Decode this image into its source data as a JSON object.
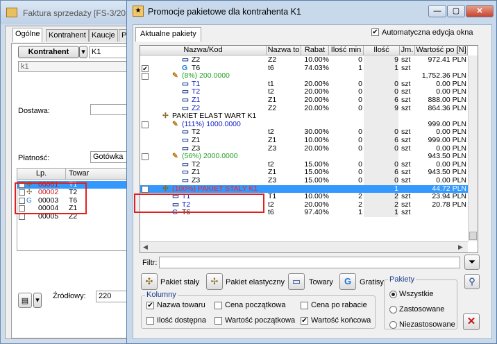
{
  "back": {
    "title": "Faktura sprzedaży [FS-3/201",
    "tabs": [
      "Ogólne",
      "Kontrahent",
      "Kaucje",
      "P"
    ],
    "kontrahent_button": "Kontrahent",
    "kontrahent_value": "K1",
    "kontrahent_name": "k1",
    "dostawa_label": "Dostawa:",
    "platnosc_label": "Płatność:",
    "platnosc_value": "Gotówka",
    "cols": [
      "Lp.",
      "Towar"
    ],
    "rows": [
      {
        "lp": "00001",
        "towar": "T1",
        "red": true,
        "sel": true
      },
      {
        "lp": "00002",
        "towar": "T2",
        "red": true
      },
      {
        "lp": "00003",
        "towar": "T6"
      },
      {
        "lp": "00004",
        "towar": "Z1"
      },
      {
        "lp": "00005",
        "towar": "Z2"
      }
    ],
    "zrodlowy_label": "Źródłowy:",
    "zrodlowy_value": "220"
  },
  "front": {
    "title": "Promocje pakietowe dla kontrahenta K1",
    "tab": "Aktualne pakiety",
    "auto_edit": "Automatyczna edycja okna",
    "grid": {
      "headers": [
        "Nazwa/Kod",
        "Nazwa to",
        "Rabat",
        "Ilość min",
        "Ilość",
        "Jm.",
        "Wartość po [N]"
      ],
      "rows": [
        {
          "name": "Z2",
          "n2": "Z2",
          "rabat": "10.00%",
          "min": "0",
          "il": "9",
          "jm": "szt",
          "war": "972.41 PLN",
          "ic": "Z",
          "lvl": 3
        },
        {
          "chk": true,
          "name": "T6",
          "n2": "t6",
          "rabat": "74.03%",
          "min": "1",
          "il": "1",
          "jm": "szt",
          "war": "",
          "ic": "G",
          "lvl": 3
        },
        {
          "chk": false,
          "name": "(8%) 200.0000",
          "n2": "",
          "rabat": "",
          "min": "",
          "il": "",
          "jm": "",
          "war": "1,752.36 PLN",
          "ic": "P",
          "lvl": 2,
          "col": "#22a022"
        },
        {
          "name": "T1",
          "n2": "t1",
          "rabat": "20.00%",
          "min": "0",
          "il": "0",
          "jm": "szt",
          "war": "0.00 PLN",
          "ic": "Z",
          "lvl": 3,
          "col": "#1020c0"
        },
        {
          "name": "T2",
          "n2": "t2",
          "rabat": "20.00%",
          "min": "0",
          "il": "0",
          "jm": "szt",
          "war": "0.00 PLN",
          "ic": "Z",
          "lvl": 3,
          "col": "#1020c0"
        },
        {
          "name": "Z1",
          "n2": "Z1",
          "rabat": "20.00%",
          "min": "0",
          "il": "6",
          "jm": "szt",
          "war": "888.00 PLN",
          "ic": "Z",
          "lvl": 3,
          "col": "#1020c0"
        },
        {
          "name": "Z2",
          "n2": "Z2",
          "rabat": "20.00%",
          "min": "0",
          "il": "9",
          "jm": "szt",
          "war": "864.36 PLN",
          "ic": "Z",
          "lvl": 3,
          "col": "#1020c0"
        },
        {
          "name": "PAKIET ELAST WART K1",
          "n2": "",
          "rabat": "",
          "min": "",
          "il": "",
          "jm": "",
          "war": "",
          "ic": "E",
          "lvl": 1
        },
        {
          "chk": false,
          "name": "(111%) 1000.0000",
          "n2": "",
          "rabat": "",
          "min": "",
          "il": "",
          "jm": "",
          "war": "999.00 PLN",
          "ic": "P",
          "lvl": 2,
          "col": "#1020c0"
        },
        {
          "name": "T2",
          "n2": "t2",
          "rabat": "30.00%",
          "min": "0",
          "il": "0",
          "jm": "szt",
          "war": "0.00 PLN",
          "ic": "Z",
          "lvl": 3
        },
        {
          "name": "Z1",
          "n2": "Z1",
          "rabat": "10.00%",
          "min": "0",
          "il": "6",
          "jm": "szt",
          "war": "999.00 PLN",
          "ic": "Z",
          "lvl": 3
        },
        {
          "name": "Z3",
          "n2": "Z3",
          "rabat": "20.00%",
          "min": "0",
          "il": "0",
          "jm": "szt",
          "war": "0.00 PLN",
          "ic": "Z",
          "lvl": 3
        },
        {
          "chk": false,
          "name": "(56%) 2000.0000",
          "n2": "",
          "rabat": "",
          "min": "",
          "il": "",
          "jm": "",
          "war": "943.50 PLN",
          "ic": "P",
          "lvl": 2,
          "col": "#22a022"
        },
        {
          "name": "T2",
          "n2": "t2",
          "rabat": "15.00%",
          "min": "0",
          "il": "0",
          "jm": "szt",
          "war": "0.00 PLN",
          "ic": "Z",
          "lvl": 3
        },
        {
          "name": "Z1",
          "n2": "Z1",
          "rabat": "15.00%",
          "min": "0",
          "il": "6",
          "jm": "szt",
          "war": "943.50 PLN",
          "ic": "Z",
          "lvl": 3
        },
        {
          "name": "Z3",
          "n2": "Z3",
          "rabat": "15.00%",
          "min": "0",
          "il": "0",
          "jm": "szt",
          "war": "0.00 PLN",
          "ic": "Z",
          "lvl": 3
        },
        {
          "chk": true,
          "name": "(100%) PAKIET STALY K1",
          "n2": "",
          "rabat": "",
          "min": "",
          "il": "1",
          "jm": "",
          "war": "44.72 PLN",
          "ic": "S",
          "lvl": 1,
          "sel": true
        },
        {
          "name": "T1",
          "n2": "T1",
          "rabat": "10.00%",
          "min": "2",
          "il": "2",
          "jm": "szt",
          "war": "23.94 PLN",
          "ic": "Z",
          "lvl": 2,
          "col": "#1020c0"
        },
        {
          "name": "T2",
          "n2": "t2",
          "rabat": "20.00%",
          "min": "2",
          "il": "2",
          "jm": "szt",
          "war": "20.78 PLN",
          "ic": "Z",
          "lvl": 2,
          "col": "#1020c0"
        },
        {
          "name": "T6",
          "n2": "t6",
          "rabat": "97.40%",
          "min": "1",
          "il": "1",
          "jm": "szt",
          "war": "",
          "ic": "G",
          "lvl": 2
        }
      ]
    },
    "filtr_label": "Filtr:",
    "legend": [
      "Pakiet stały",
      "Pakiet elastyczny",
      "Towary",
      "Gratisy"
    ],
    "kolumny_label": "Kolumny",
    "kolumny": [
      {
        "label": "Nazwa towaru",
        "on": true
      },
      {
        "label": "Cena początkowa",
        "on": false
      },
      {
        "label": "Cena po rabacie",
        "on": false
      },
      {
        "label": "Ilość dostępna",
        "on": false
      },
      {
        "label": "Wartość początkowa",
        "on": false
      },
      {
        "label": "Wartość końcowa",
        "on": true
      }
    ],
    "pakiety_label": "Pakiety",
    "pakiety": [
      {
        "label": "Wszystkie",
        "on": true
      },
      {
        "label": "Zastosowane",
        "on": false
      },
      {
        "label": "Niezastosowane",
        "on": false
      }
    ]
  }
}
